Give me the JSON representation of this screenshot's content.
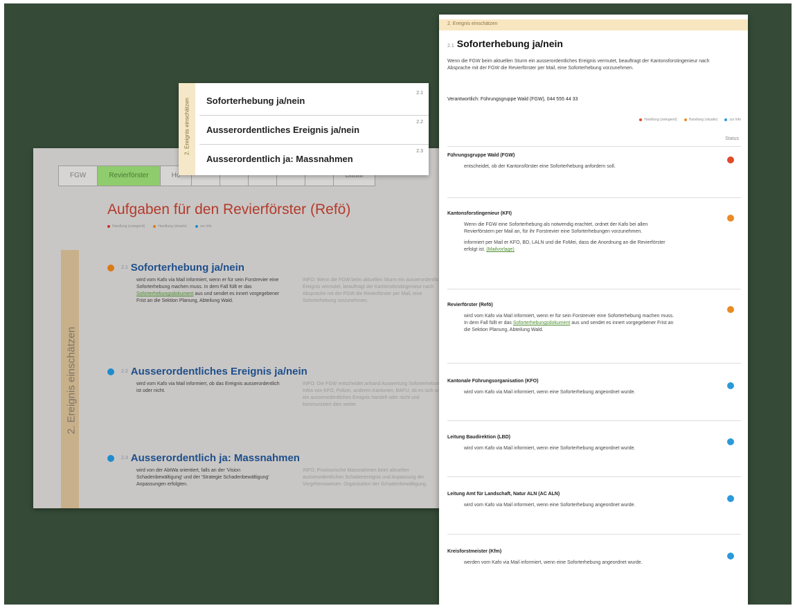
{
  "colors": {
    "red": "#e04a2a",
    "orange": "#ea8a23",
    "blue": "#2c99db",
    "board": "#354a37"
  },
  "legend": [
    {
      "label": "Handlung (zwingend)",
      "color": "#e04a2a"
    },
    {
      "label": "Handlung (situativ)",
      "color": "#ea8a23"
    },
    {
      "label": "zur Info",
      "color": "#2c99db"
    }
  ],
  "background_page": {
    "tabs": [
      "FGW",
      "Revierförster",
      "Ho",
      "",
      "",
      "",
      "",
      "",
      "Bauaf"
    ],
    "title": "Aufgaben für den Revierförster (Refö)",
    "side_label": "2. Ereignis einschätzen",
    "tasks": [
      {
        "num": "2.1",
        "title": "Soforterhebung ja/nein",
        "color": "#ea8a23",
        "body_pre": "wird vom Kafo via Mail informiert, wenn er für sein Forstrevier eine Soforterhebung machen muss. In dem Fall füllt er das",
        "body_link": "Soforterhebungsdokument",
        "body_post": "aus und sendet es innert vorgegebener Frist an die Sektion Planung, Abteilung Wald.",
        "info": "INFO: Wenn die FGW beim aktuellen Sturm ein ausserordentliches Ereignis vermutet, beauftragt der Kantonsforstingenieur nach Absprache mit der FGW die Revierförster per Mail, eine Soforterhebung vorzunehmen."
      },
      {
        "num": "2.2",
        "title": "Ausserordentliches Ereignis ja/nein",
        "color": "#2c99db",
        "body_pre": "wird vom Kafo via Mail informiert, ob das Ereignis ausserordentlich ist oder nicht.",
        "body_link": "",
        "body_post": "",
        "info": "INFO: Die FGW entscheidet anhand Auswertung Soforterhebung, Infos von KFO, Polizei, anderen Kantonen, BAFU, ob es sich um ein ausserordentliches Ereignis handelt oder nicht und kommuniziert dies weiter."
      },
      {
        "num": "2.3",
        "title": "Ausserordentlich ja: Massnahmen",
        "color": "#2c99db",
        "body_pre": "wird von der AbtWa orientiert, falls an der 'Vision Schadenbewältigung' und der 'Strategie Schadenbewältigung' Anpassungen erfolgten.",
        "body_link": "",
        "body_post": "",
        "info": "INFO: Provisorische Massnahmen beim aktuellen ausserordentlichen Schadenereignis und Anpassung der Vorgehensweisen. Organisation der Schadenbewältigung."
      }
    ]
  },
  "popup": {
    "side_label": "2. Ereignis einschätzen",
    "items": [
      {
        "num": "2.1",
        "label": "Soforterhebung ja/nein"
      },
      {
        "num": "2.2",
        "label": "Ausserordentliches Ereignis ja/nein"
      },
      {
        "num": "2.3",
        "label": "Ausserordentlich ja: Massnahmen"
      }
    ]
  },
  "sheet": {
    "band": "2. Ereignis einschätzen",
    "num": "2.1",
    "title": "Soforterhebung ja/nein",
    "intro": "Wenn die FGW beim aktuellen Sturm ein ausserordentliches Ereignis vermutet, beauftragt der Kantonsforstingenieur nach Absprache mit der FGW die Revierförster per Mail, eine Soforterhebung vorzunehmen.",
    "responsible": "Verantwortlich: Führungsgruppe Wald (FGW), 044 555 44 33",
    "status_header": "Status",
    "orgs": [
      {
        "name": "Führungsgruppe Wald (FGW)",
        "color": "#e04a2a",
        "paras": [
          "entscheidet, ob der Kantonsförster eine Soforterhebung anfordern soll."
        ]
      },
      {
        "name": "Kantonsforstingenieur (KFI)",
        "color": "#ea8a23",
        "paras": [
          "Wenn die FGW eine Soforterhebung als notwendig erachtet, ordnet der Kafo bei allen Revierförstern per Mail an, für ihr Forstrevier eine Soforterhebungen vorzunehmen.",
          "informiert per Mail er KFO, BD, LALN und die FoMei, dass die Anordnung an die Revierförster erfolgt ist."
        ],
        "link": "(Mailvorlage)"
      },
      {
        "name": "Revierförster (Refö)",
        "color": "#ea8a23",
        "paras": [
          "wird vom Kafo via Mail informiert, wenn er für sein Forstrevier eine Soforterhebung machen muss. In dem Fall füllt er das"
        ],
        "link": "Soforterhebungsdokument",
        "after": "aus und sendet es innert vorgegebener Frist an die Sektion Planung, Abteilung Wald."
      },
      {
        "name": "Kantonale Führungsorganisation (KFO)",
        "color": "#2c99db",
        "paras": [
          "wird vom Kafo via Mail informiert, wenn eine Soforterhebung angeordnet wurde."
        ]
      },
      {
        "name": "Leitung Baudirektion (LBD)",
        "color": "#2c99db",
        "paras": [
          "wird vom Kafo via Mail informiert, wenn eine Soforterhebung angeordnet wurde."
        ]
      },
      {
        "name": "Leitung Amt für Landschaft, Natur ALN (AC ALN)",
        "color": "#2c99db",
        "paras": [
          "wird vom Kafo via Mail informiert, wenn eine Soforterhebung angeordnet wurde."
        ]
      },
      {
        "name": "Kreisforstmeister  (Kfm)",
        "color": "#2c99db",
        "paras": [
          "werden vom Kafo via Mail informiert, wenn eine Soforterhebung angeordnet wurde."
        ]
      }
    ]
  }
}
